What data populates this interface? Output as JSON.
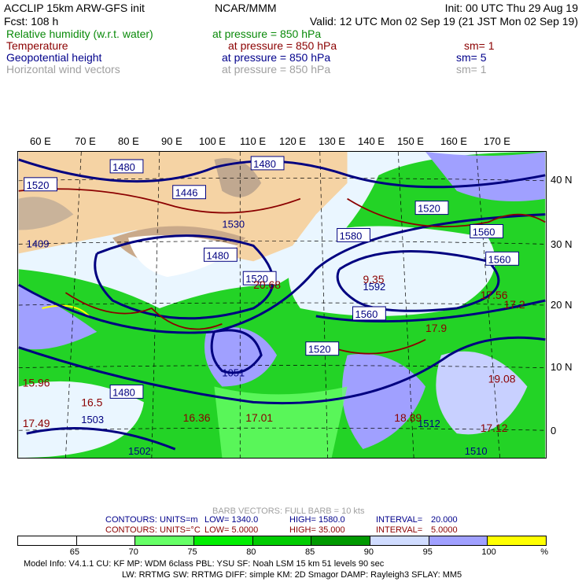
{
  "header": {
    "title": "ACCLIP 15km ARW-GFS init",
    "org": "NCAR/MMM",
    "init": "Init: 00 UTC Thu 29 Aug 19",
    "fcst": "Fcst:  108 h",
    "valid": "Valid: 12 UTC Mon 02 Sep 19 (21 JST Mon 02 Sep 19)"
  },
  "fields": [
    {
      "name": "Relative humidity (w.r.t. water)",
      "level": "at pressure =  850 hPa",
      "sm": "",
      "color": "#0a8a0a"
    },
    {
      "name": "Temperature",
      "level": "at pressure =  850 hPa",
      "sm": "sm= 1",
      "color": "#8b0000"
    },
    {
      "name": "Geopotential height",
      "level": "at pressure =  850 hPa",
      "sm": "sm= 5",
      "color": "#00008b"
    },
    {
      "name": "Horizontal wind vectors",
      "level": "at pressure =  850 hPa",
      "sm": "sm= 1",
      "color": "#a0a0a0"
    }
  ],
  "map": {
    "lon_labels": [
      "60 E",
      "70 E",
      "80 E",
      "90 E",
      "100 E",
      "110 E",
      "120 E",
      "130 E",
      "140 E",
      "150 E",
      "160 E",
      "170 E"
    ],
    "lat_labels": [
      "40 N",
      "30 N",
      "20 N",
      "10 N",
      "0"
    ],
    "height_labels": [
      "1480",
      "1446",
      "1530",
      "1480",
      "1520",
      "1520",
      "1480",
      "1520",
      "1580",
      "1560",
      "1560",
      "1592",
      "1560",
      "1520",
      "1480",
      "1409",
      "1503",
      "1502",
      "1512",
      "1510",
      "1051"
    ],
    "temp_labels": [
      "9.35",
      "17.56",
      "17.9",
      "17.2",
      "19.08",
      "18.89",
      "17.12",
      "16.5",
      "15.96",
      "17.49",
      "20.68",
      "16.36",
      "17.01"
    ]
  },
  "legend": {
    "barb": "BARB VECTORS:  FULL BARB = 10 kts",
    "height_contours": {
      "label": "CONTOURS:",
      "units": "UNITS=m",
      "low": "LOW=  1340.0",
      "high": "HIGH=  1580.0",
      "interval": "INTERVAL=",
      "interval_val": "20.000"
    },
    "temp_contours": {
      "label": "CONTOURS:",
      "units": "UNITS=°C",
      "low": "LOW=  5.0000",
      "high": "HIGH=  35.000",
      "interval": "INTERVAL=",
      "interval_val": "5.0000"
    },
    "colorbar": {
      "colors": [
        "#ffffff",
        "#ffffff",
        "#66ff66",
        "#00ee00",
        "#00cc00",
        "#009900",
        "#d0dcff",
        "#a0a0ff",
        "#ffff00"
      ],
      "ticks": [
        "65",
        "70",
        "75",
        "80",
        "85",
        "90",
        "95",
        "100",
        "%"
      ]
    }
  },
  "model_info": {
    "line1": "Model Info: V4.1.1     CU: KF       MP: WDM 6class   PBL: YSU        SF: Noah LSM      15 km    51 levels    90 sec",
    "line2": "LW: RRTMG     SW: RRTMG    DIFF: simple KM: 2D Smagor DAMP: Rayleigh3   SFLAY: MM5"
  }
}
